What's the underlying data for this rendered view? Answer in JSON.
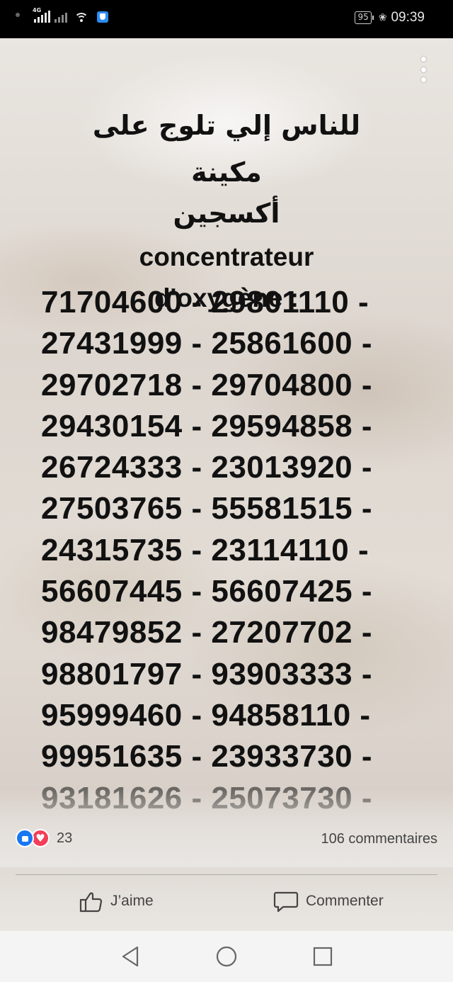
{
  "status_bar": {
    "network_type": "4G",
    "battery": "95",
    "time": "09:39"
  },
  "post": {
    "arabic_line1": "للناس إلي تلوج على مكينة",
    "arabic_line2": "أكسجين",
    "latin_line1": "concentrateur",
    "latin_line2": "d'oxygène :",
    "number_rows": [
      "71704600 - 29801110 -",
      "27431999 - 25861600 -",
      "29702718 - 29704800 -",
      "29430154 - 29594858 -",
      "26724333 - 23013920 -",
      "27503765 - 55581515 -",
      "24315735 - 23114110 -",
      "56607445 - 56607425 -",
      "98479852 - 27207702 -",
      "98801797 - 93903333 -",
      "95999460 - 94858110 -",
      "99951635 - 23933730 -",
      "93181626 - 25073730 -"
    ]
  },
  "reactions": {
    "count": "23",
    "icons": [
      "like-icon",
      "love-icon"
    ],
    "like_color": "#1877f2",
    "love_color": "#f33e58"
  },
  "comments": {
    "count_label": "106 commentaires"
  },
  "actions": {
    "like_label": "J’aime",
    "comment_label": "Commenter"
  },
  "nav": {
    "icons": [
      "back-icon",
      "home-icon",
      "recents-icon"
    ]
  }
}
